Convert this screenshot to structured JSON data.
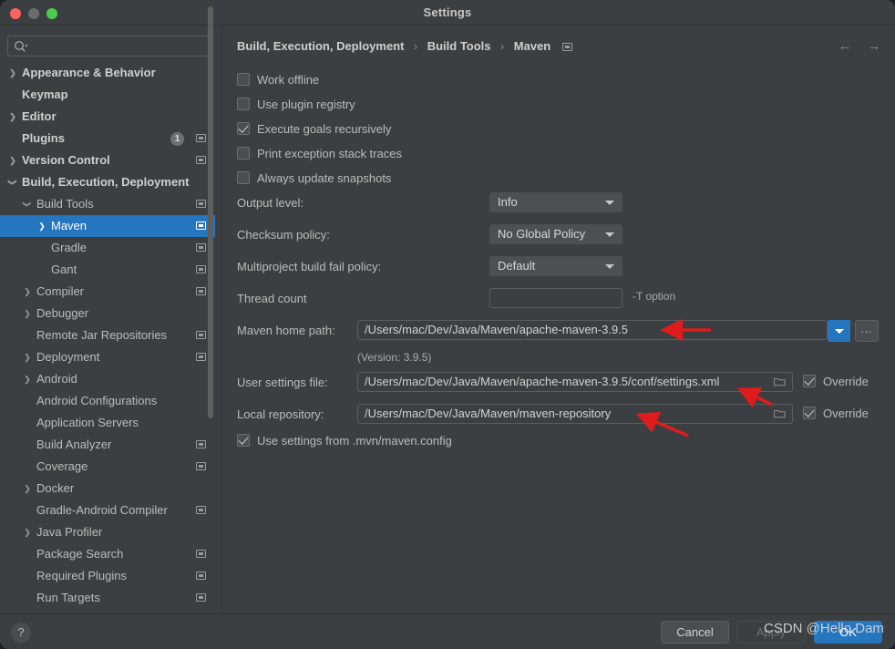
{
  "window": {
    "title": "Settings",
    "traffic_lights": [
      "close",
      "minimize",
      "maximize"
    ],
    "colors": {
      "accent": "#2675bf",
      "background": "#3c3f41",
      "text": "#bbbbbb",
      "annotation": "#e01b1b"
    }
  },
  "search": {
    "placeholder": "",
    "value": "",
    "icon": "search-icon"
  },
  "sidebar": {
    "items": [
      {
        "label": "Appearance & Behavior",
        "indent": 0,
        "arrow": "collapsed",
        "bold": true,
        "selected": false,
        "icon": false,
        "badge": null
      },
      {
        "label": "Keymap",
        "indent": 0,
        "arrow": "none",
        "bold": true,
        "selected": false,
        "icon": false,
        "badge": null
      },
      {
        "label": "Editor",
        "indent": 0,
        "arrow": "collapsed",
        "bold": true,
        "selected": false,
        "icon": false,
        "badge": null
      },
      {
        "label": "Plugins",
        "indent": 0,
        "arrow": "none",
        "bold": true,
        "selected": false,
        "icon": true,
        "badge": "1"
      },
      {
        "label": "Version Control",
        "indent": 0,
        "arrow": "collapsed",
        "bold": true,
        "selected": false,
        "icon": true,
        "badge": null
      },
      {
        "label": "Build, Execution, Deployment",
        "indent": 0,
        "arrow": "expanded",
        "bold": true,
        "selected": false,
        "icon": false,
        "badge": null
      },
      {
        "label": "Build Tools",
        "indent": 1,
        "arrow": "expanded",
        "bold": false,
        "selected": false,
        "icon": true,
        "badge": null
      },
      {
        "label": "Maven",
        "indent": 2,
        "arrow": "collapsed",
        "bold": false,
        "selected": true,
        "icon": true,
        "badge": null
      },
      {
        "label": "Gradle",
        "indent": 2,
        "arrow": "none",
        "bold": false,
        "selected": false,
        "icon": true,
        "badge": null
      },
      {
        "label": "Gant",
        "indent": 2,
        "arrow": "none",
        "bold": false,
        "selected": false,
        "icon": true,
        "badge": null
      },
      {
        "label": "Compiler",
        "indent": 1,
        "arrow": "collapsed",
        "bold": false,
        "selected": false,
        "icon": true,
        "badge": null
      },
      {
        "label": "Debugger",
        "indent": 1,
        "arrow": "collapsed",
        "bold": false,
        "selected": false,
        "icon": false,
        "badge": null
      },
      {
        "label": "Remote Jar Repositories",
        "indent": 1,
        "arrow": "none",
        "bold": false,
        "selected": false,
        "icon": true,
        "badge": null
      },
      {
        "label": "Deployment",
        "indent": 1,
        "arrow": "collapsed",
        "bold": false,
        "selected": false,
        "icon": true,
        "badge": null
      },
      {
        "label": "Android",
        "indent": 1,
        "arrow": "collapsed",
        "bold": false,
        "selected": false,
        "icon": false,
        "badge": null
      },
      {
        "label": "Android Configurations",
        "indent": 1,
        "arrow": "none",
        "bold": false,
        "selected": false,
        "icon": false,
        "badge": null
      },
      {
        "label": "Application Servers",
        "indent": 1,
        "arrow": "none",
        "bold": false,
        "selected": false,
        "icon": false,
        "badge": null
      },
      {
        "label": "Build Analyzer",
        "indent": 1,
        "arrow": "none",
        "bold": false,
        "selected": false,
        "icon": true,
        "badge": null
      },
      {
        "label": "Coverage",
        "indent": 1,
        "arrow": "none",
        "bold": false,
        "selected": false,
        "icon": true,
        "badge": null
      },
      {
        "label": "Docker",
        "indent": 1,
        "arrow": "collapsed",
        "bold": false,
        "selected": false,
        "icon": false,
        "badge": null
      },
      {
        "label": "Gradle-Android Compiler",
        "indent": 1,
        "arrow": "none",
        "bold": false,
        "selected": false,
        "icon": true,
        "badge": null
      },
      {
        "label": "Java Profiler",
        "indent": 1,
        "arrow": "collapsed",
        "bold": false,
        "selected": false,
        "icon": false,
        "badge": null
      },
      {
        "label": "Package Search",
        "indent": 1,
        "arrow": "none",
        "bold": false,
        "selected": false,
        "icon": true,
        "badge": null
      },
      {
        "label": "Required Plugins",
        "indent": 1,
        "arrow": "none",
        "bold": false,
        "selected": false,
        "icon": true,
        "badge": null
      },
      {
        "label": "Run Targets",
        "indent": 1,
        "arrow": "none",
        "bold": false,
        "selected": false,
        "icon": true,
        "badge": null
      }
    ]
  },
  "breadcrumb": {
    "parts": [
      "Build, Execution, Deployment",
      "Build Tools",
      "Maven"
    ],
    "separator": "›"
  },
  "nav": {
    "back_icon": "arrow-left-icon",
    "forward_icon": "arrow-right-icon"
  },
  "main": {
    "checkboxes": [
      {
        "label": "Work offline",
        "checked": false
      },
      {
        "label": "Use plugin registry",
        "checked": false
      },
      {
        "label": "Execute goals recursively",
        "checked": true
      },
      {
        "label": "Print exception stack traces",
        "checked": false
      },
      {
        "label": "Always update snapshots",
        "checked": false
      }
    ],
    "combos": [
      {
        "label": "Output level:",
        "value": "Info"
      },
      {
        "label": "Checksum policy:",
        "value": "No Global Policy"
      },
      {
        "label": "Multiproject build fail policy:",
        "value": "Default"
      }
    ],
    "thread_count": {
      "label": "Thread count",
      "value": "",
      "hint": "-T option"
    },
    "maven_home": {
      "label": "Maven home path:",
      "value": "/Users/mac/Dev/Java/Maven/apache-maven-3.9.5",
      "version_note": "(Version: 3.9.5)",
      "browse_label": "..."
    },
    "user_settings": {
      "label": "User settings file:",
      "value": "/Users/mac/Dev/Java/Maven/apache-maven-3.9.5/conf/settings.xml",
      "override_label": "Override",
      "override_checked": true
    },
    "local_repository": {
      "label": "Local repository:",
      "value": "/Users/mac/Dev/Java/Maven/maven-repository",
      "override_label": "Override",
      "override_checked": true
    },
    "mvn_config": {
      "label": "Use settings from .mvn/maven.config",
      "checked": true
    }
  },
  "footer": {
    "help_label": "?",
    "cancel_label": "Cancel",
    "apply_label": "Apply",
    "ok_label": "OK"
  },
  "watermark": {
    "text": "CSDN @Hello Dam"
  }
}
